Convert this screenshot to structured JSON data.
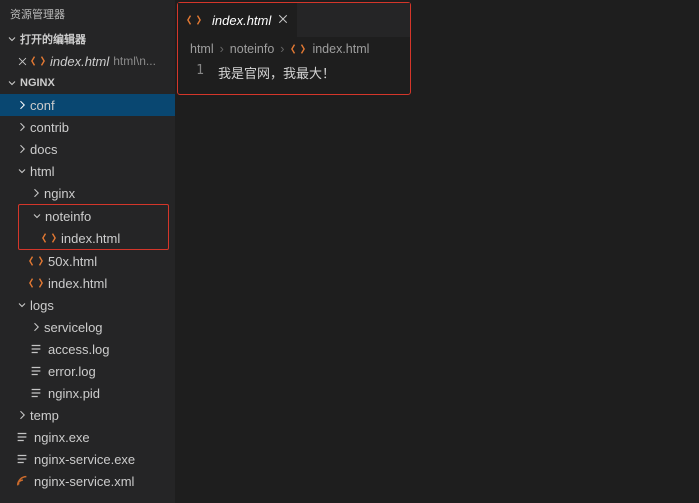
{
  "sidebar": {
    "title": "资源管理器",
    "openEditors": {
      "label": "打开的编辑器",
      "items": [
        {
          "name": "index.html",
          "desc": "html\\n..."
        }
      ]
    },
    "project": {
      "label": "NGINX",
      "tree": {
        "conf": "conf",
        "contrib": "contrib",
        "docs": "docs",
        "html": "html",
        "nginx": "nginx",
        "noteinfo": "noteinfo",
        "noteinfo_index": "index.html",
        "fiftyx": "50x.html",
        "html_index": "index.html",
        "logs": "logs",
        "servicelog": "servicelog",
        "accesslog": "access.log",
        "errorlog": "error.log",
        "nginxpid": "nginx.pid",
        "temp": "temp",
        "nginxexe": "nginx.exe",
        "nginxserviceexe": "nginx-service.exe",
        "nginxservicexml": "nginx-service.xml"
      }
    }
  },
  "editor": {
    "tab": {
      "name": "index.html"
    },
    "breadcrumb": {
      "c1": "html",
      "c2": "noteinfo",
      "c3": "index.html"
    },
    "line1_no": "1",
    "line1_text": "我是官网，我最大！"
  }
}
